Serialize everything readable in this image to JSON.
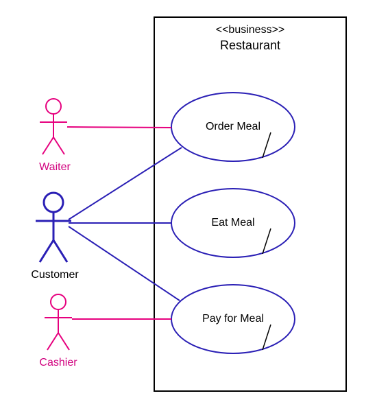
{
  "diagram": {
    "type": "uml-use-case",
    "system": {
      "stereotype": "<<business>>",
      "name": "Restaurant"
    },
    "actors": {
      "waiter": {
        "name": "Waiter",
        "role": "secondary",
        "color": "#e6007e"
      },
      "customer": {
        "name": "Customer",
        "role": "primary",
        "color": "#2a1fb5"
      },
      "cashier": {
        "name": "Cashier",
        "role": "secondary",
        "color": "#e6007e"
      }
    },
    "usecases": {
      "order": {
        "label": "Order Meal"
      },
      "eat": {
        "label": "Eat Meal"
      },
      "pay": {
        "label": "Pay for Meal"
      }
    },
    "associations": [
      {
        "from": "waiter",
        "to": "order"
      },
      {
        "from": "customer",
        "to": "order"
      },
      {
        "from": "customer",
        "to": "eat"
      },
      {
        "from": "customer",
        "to": "pay"
      },
      {
        "from": "cashier",
        "to": "pay"
      }
    ],
    "colors": {
      "primaryStroke": "#2a1fb5",
      "secondaryStroke": "#e6007e",
      "boundary": "#000000"
    }
  }
}
